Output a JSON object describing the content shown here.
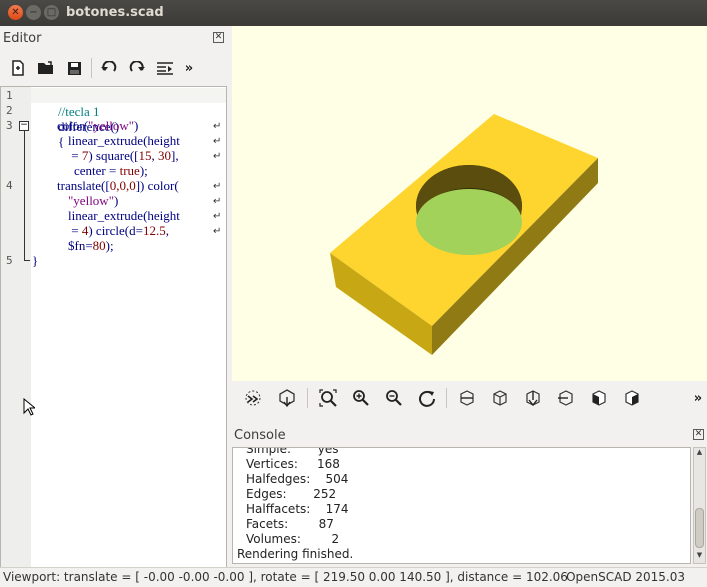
{
  "window": {
    "title": "botones.scad"
  },
  "editor": {
    "title": "Editor",
    "close_icon": "✕",
    "toolbar": [
      "new-file-icon",
      "open-file-icon",
      "save-icon",
      "undo-icon",
      "redo-icon",
      "indent-icon",
      "more-icon"
    ],
    "more_label": "»",
    "line_numbers": [
      "1",
      "2",
      "3",
      "4",
      "5"
    ],
    "fold_toggle": "−",
    "code": {
      "l1": "//tecla 1",
      "l2": "difference()",
      "l3_brace": "{",
      "l3_color": "color(",
      "l3_str": "\"yellow\"",
      "l3_end": ")",
      "l3b_kw": "linear_extrude(height",
      "l3c_eq": " = ",
      "l3c_num": "7",
      "l3c_rest": ") square([",
      "l3c_n1": "15",
      "l3c_comma": ", ",
      "l3c_n2": "30",
      "l3c_end": "],",
      "l3d_kw": "center",
      "l3d_eq": " = ",
      "l3d_val": "true",
      "l3d_end": ");",
      "l4_kw": "translate([",
      "l4_n": "0,0,0",
      "l4_mid": "]) color(",
      "l4b_str": "\"yellow\"",
      "l4b_end": ")",
      "l4c_kw": "linear_extrude(height",
      "l4d_eq": " = ",
      "l4d_num": "4",
      "l4d_mid": ") circle(d=",
      "l4d_n": "12.5",
      "l4d_end": ",",
      "l4e_kw": "$fn=",
      "l4e_n": "80",
      "l4e_end": ");",
      "l5": "}"
    },
    "wrap_glyph": "↵"
  },
  "view_toolbar": [
    "preview-icon",
    "render-icon",
    "view-all-icon",
    "zoom-in-icon",
    "zoom-out-icon",
    "reset-view-icon",
    "right-view-icon",
    "top-view-icon",
    "bottom-view-icon",
    "left-view-icon",
    "front-view-icon",
    "back-view-icon",
    "more-icon"
  ],
  "console": {
    "title": "Console",
    "lines": [
      {
        "label": "Simple:",
        "value": "yes"
      },
      {
        "label": "Vertices:",
        "value": "168"
      },
      {
        "label": "Halfedges:",
        "value": "504"
      },
      {
        "label": "Edges:",
        "value": "252"
      },
      {
        "label": "Halffacets:",
        "value": "174"
      },
      {
        "label": "Facets:",
        "value": "87"
      },
      {
        "label": "Volumes:",
        "value": "2"
      }
    ],
    "final": "Rendering finished."
  },
  "status": {
    "viewport": "Viewport: translate = [ -0.00 -0.00 -0.00 ], rotate = [ 219.50 0.00 140.50 ], distance = 102.06",
    "version": "OpenSCAD 2015.03"
  },
  "colors": {
    "model_top": "#fed42f",
    "model_side_left": "#c8a715",
    "model_side_front": "#8f7a14",
    "hole_bottom": "#a2d25a",
    "viewport_bg": "#ffffe5"
  }
}
